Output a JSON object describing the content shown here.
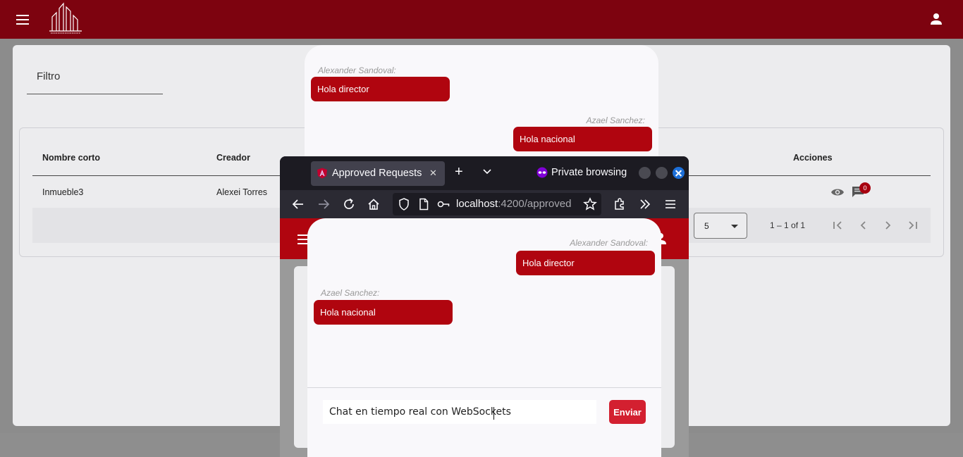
{
  "colors": {
    "toolbar": "#7d030f",
    "bubble": "#b0050f",
    "send_button": "#d32030",
    "firefox_chrome": "#2b2a33"
  },
  "background_app": {
    "toolbar": {
      "menu_icon": "menu-icon",
      "logo_icon": "building-logo",
      "user_icon": "account-icon"
    },
    "filter": {
      "label": "Filtro"
    },
    "table": {
      "headers": {
        "nombre_corto": "Nombre corto",
        "creador": "Creador",
        "acciones": "Acciones"
      },
      "rows": [
        {
          "nombre_corto": "Inmueble3",
          "creador": "Alexei Torres",
          "chat_badge": "0"
        }
      ]
    },
    "paginator": {
      "page_size": "5",
      "range": "1 – 1 of 1"
    }
  },
  "chat_window_1": {
    "messages": [
      {
        "sender": "Alexander Sandoval:",
        "text": "Hola director"
      },
      {
        "sender": "Azael Sanchez:",
        "text": "Hola nacional"
      }
    ]
  },
  "firefox": {
    "tab": {
      "title": "Approved Requests"
    },
    "private_label": "Private browsing",
    "url": {
      "host": "localhost",
      "path": ":4200/approved"
    }
  },
  "chat_window_2": {
    "messages": [
      {
        "sender": "Alexander Sandoval:",
        "text": "Hola director"
      },
      {
        "sender": "Azael Sanchez:",
        "text": "Hola nacional"
      }
    ],
    "input_value": "Chat en tiempo real con WebSockets",
    "send_label": "Enviar"
  }
}
